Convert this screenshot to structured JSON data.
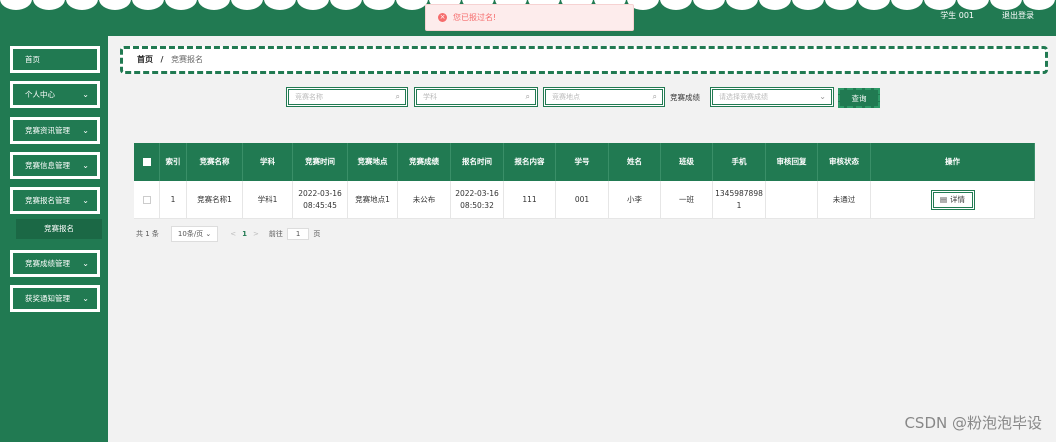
{
  "header": {
    "user": "学生 001",
    "logout": "退出登录"
  },
  "toast": {
    "message": "您已报过名!"
  },
  "sidebar": {
    "items": [
      {
        "label": "首页",
        "chev": ""
      },
      {
        "label": "个人中心",
        "chev": "⌄"
      },
      {
        "label": "竞赛资讯管理",
        "chev": "⌄"
      },
      {
        "label": "竞赛信息管理",
        "chev": "⌄"
      },
      {
        "label": "竞赛报名管理",
        "chev": "⌄"
      },
      {
        "label": "竞赛成绩管理",
        "chev": "⌄"
      },
      {
        "label": "获奖通知管理",
        "chev": "⌄"
      }
    ],
    "sub_active": "竞赛报名"
  },
  "breadcrumb": {
    "home": "首页",
    "sep": "/",
    "current": "竞赛报名"
  },
  "search": {
    "name_placeholder": "竞赛名称",
    "subject_placeholder": "学科",
    "location_placeholder": "竞赛地点",
    "grade_label": "竞赛成绩",
    "grade_placeholder": "请选择竞赛成绩",
    "query_button": "查询"
  },
  "table": {
    "columns": [
      "",
      "索引",
      "竞赛名称",
      "学科",
      "竞赛时间",
      "竞赛地点",
      "竞赛成绩",
      "报名时间",
      "报名内容",
      "学号",
      "姓名",
      "班级",
      "手机",
      "审核回复",
      "审核状态",
      "操作"
    ],
    "rows": [
      {
        "index": "1",
        "name": "竞赛名称1",
        "subject": "学科1",
        "time": "2022-03-16\n08:45:45",
        "location": "竞赛地点1",
        "grade": "未公布",
        "signup_time": "2022-03-16\n08:50:32",
        "content": "111",
        "student_no": "001",
        "student_name": "小李",
        "class": "一班",
        "phone": "1345987898\n1",
        "reply": "",
        "status": "未通过",
        "action": "详情"
      }
    ]
  },
  "pager": {
    "total": "共 1 条",
    "size": "10条/页",
    "prev": "<",
    "current": "1",
    "next": ">",
    "goto": "前往",
    "page_input": "1",
    "page_unit": "页"
  },
  "watermark": "CSDN @粉泡泡毕设"
}
